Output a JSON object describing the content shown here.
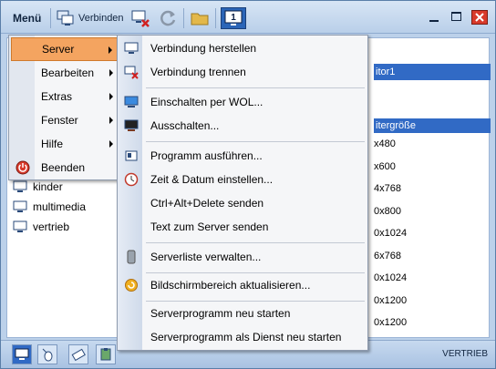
{
  "toolbar": {
    "menu_label": "Menü",
    "connect_label": "Verbinden",
    "icons": [
      "connect-icon",
      "disconnect-icon",
      "refresh-icon",
      "folder-icon",
      "monitor-1-icon"
    ],
    "monitor_number": "1"
  },
  "colors": {
    "highlight": "#f4a460",
    "selection": "#316ac5",
    "frame": "#bcd1ea"
  },
  "main_menu": {
    "items": [
      {
        "label": "Server",
        "has_submenu": true,
        "highlighted": true
      },
      {
        "label": "Bearbeiten",
        "has_submenu": true
      },
      {
        "label": "Extras",
        "has_submenu": true
      },
      {
        "label": "Fenster",
        "has_submenu": true
      },
      {
        "label": "Hilfe",
        "has_submenu": true
      },
      {
        "label": "Beenden",
        "has_submenu": false,
        "icon": "power-icon"
      }
    ]
  },
  "server_menu": {
    "items": [
      {
        "label": "Verbindung herstellen",
        "icon": "connect-icon"
      },
      {
        "label": "Verbindung trennen",
        "icon": "disconnect-icon"
      },
      {
        "label": "Einschalten per WOL...",
        "icon": "wake-on-lan-icon"
      },
      {
        "label": "Ausschalten...",
        "icon": "shutdown-icon"
      },
      {
        "label": "Programm ausführen...",
        "icon": "run-program-icon"
      },
      {
        "label": "Zeit & Datum einstellen...",
        "icon": "clock-icon"
      },
      {
        "label": "Ctrl+Alt+Delete senden",
        "icon": ""
      },
      {
        "label": "Text zum Server senden",
        "icon": ""
      },
      {
        "label": "Serverliste verwalten...",
        "icon": "server-list-icon"
      },
      {
        "label": "Bildschirmbereich aktualisieren...",
        "icon": "refresh-area-icon"
      },
      {
        "label": "Serverprogramm neu starten",
        "icon": ""
      },
      {
        "label": "Serverprogramm als Dienst neu starten",
        "icon": ""
      }
    ]
  },
  "content": {
    "selected_server_fragment": "itor1",
    "column_header_fragment": "itergröße",
    "resolutions": [
      "x480",
      "x600",
      "4x768",
      "0x800",
      "0x1024",
      "6x768",
      "0x1024",
      "0x1200",
      "0x1200"
    ],
    "left_items": [
      {
        "name": "kinder"
      },
      {
        "name": "multimedia"
      },
      {
        "name": "vertrieb"
      }
    ]
  },
  "statusbar": {
    "text": "VERTRIEB"
  }
}
